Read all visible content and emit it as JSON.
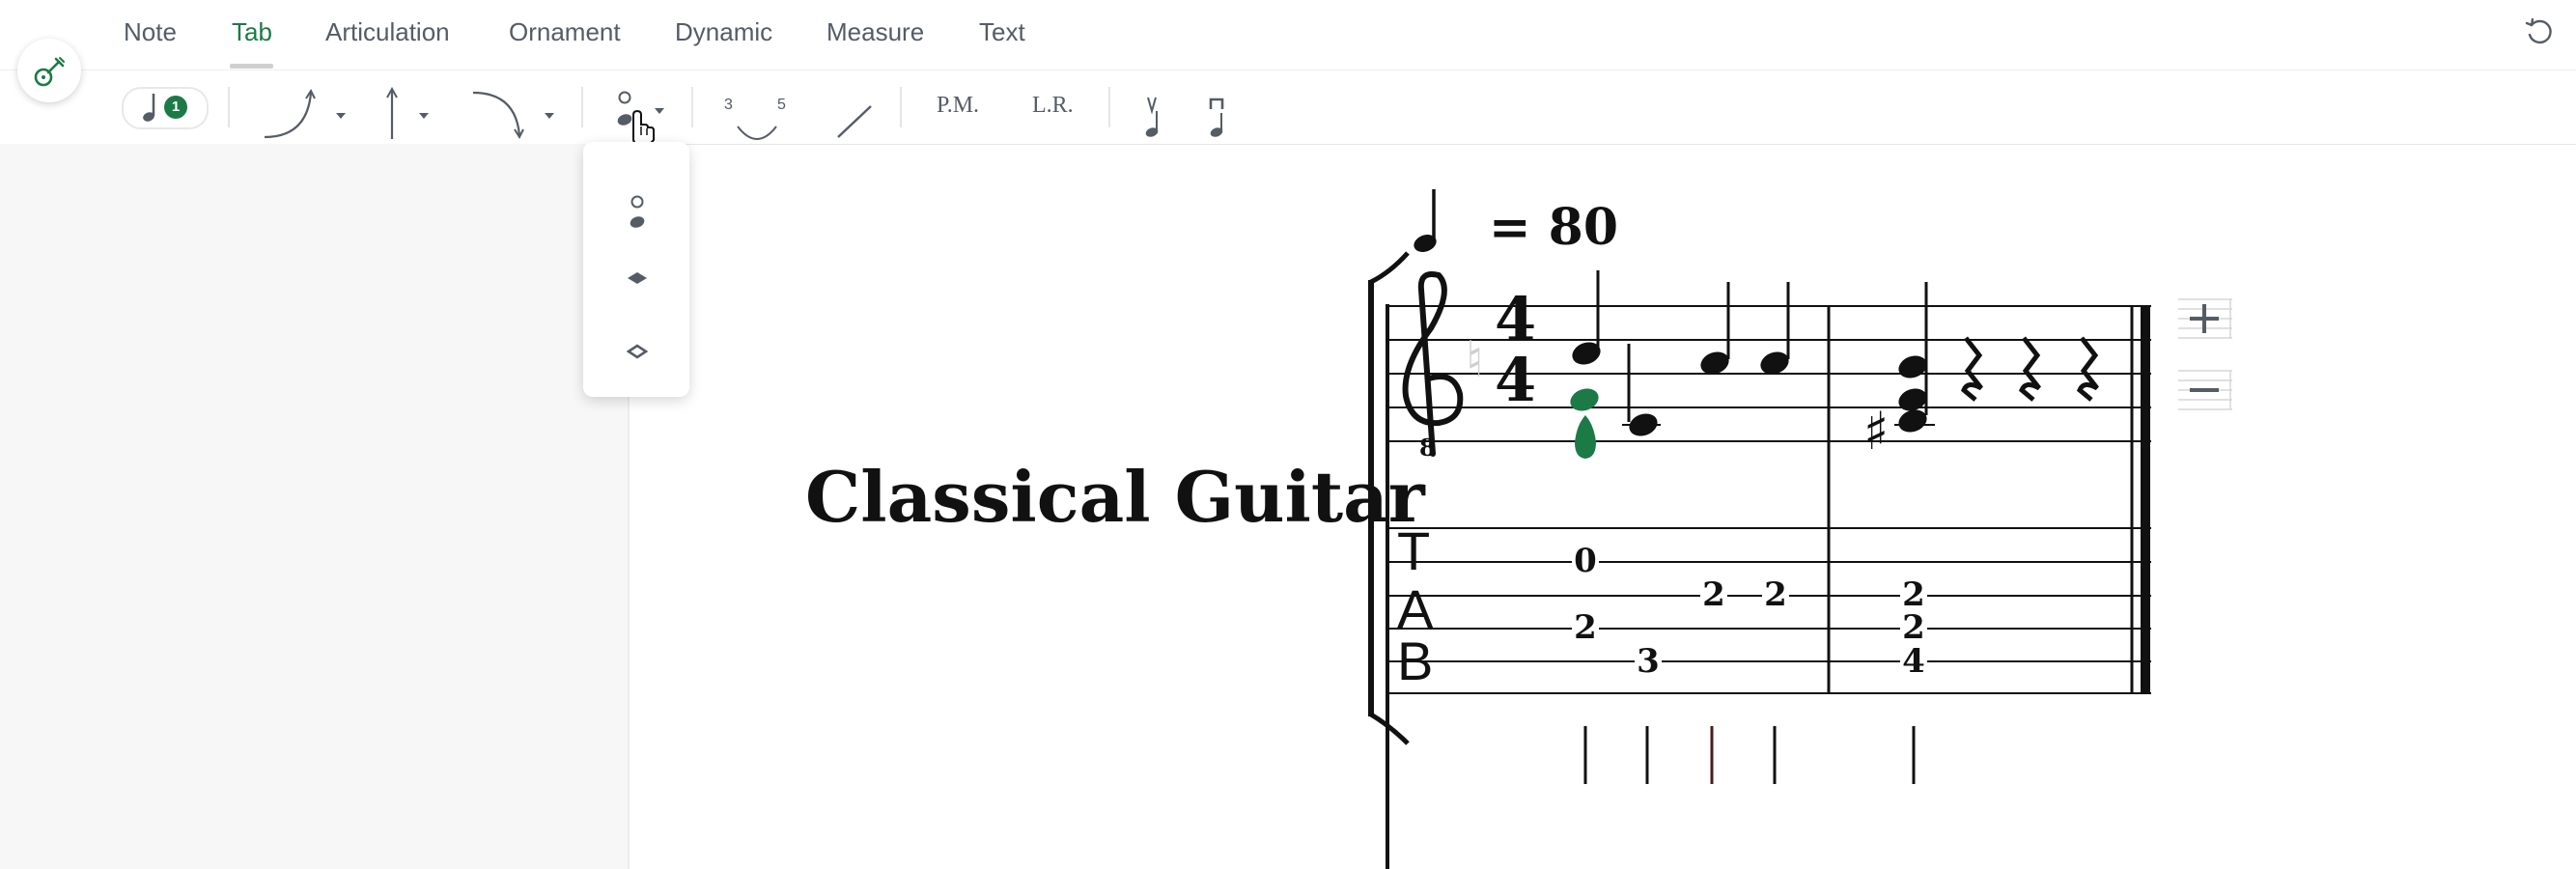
{
  "tabs": [
    {
      "label": "Note",
      "active": false
    },
    {
      "label": "Tab",
      "active": true
    },
    {
      "label": "Articulation",
      "active": false
    },
    {
      "label": "Ornament",
      "active": false
    },
    {
      "label": "Dynamic",
      "active": false
    },
    {
      "label": "Measure",
      "active": false
    },
    {
      "label": "Text",
      "active": false
    }
  ],
  "toolbar": {
    "voice_count": "1",
    "tab_number_a": "3",
    "tab_number_b": "5",
    "palm_mute_label": "P.M.",
    "let_ring_label": "L.R."
  },
  "icons": {
    "guitar": "guitar-icon",
    "undo": "undo-icon",
    "voice": "quarter-note-icon",
    "bend": "bend-icon",
    "vibrato": "vibrato-icon",
    "release": "release-icon",
    "notehead": "harmonic-notehead-icon",
    "slide": "slide-icon",
    "upstroke": "upstroke-icon",
    "downstroke": "downstroke-icon",
    "add_staff": "plus-icon",
    "remove_staff": "minus-icon"
  },
  "score": {
    "title": "Classical Guitar",
    "tempo": "= 80",
    "time_signature": "4/4",
    "tab_clef": [
      "T",
      "A",
      "B"
    ],
    "tab_numbers": [
      "0",
      "2",
      "3",
      "2",
      "2",
      "2",
      "2",
      "4"
    ]
  },
  "colors": {
    "accent": "#1b7a46",
    "ink": "#111111",
    "icon": "#555c66"
  }
}
